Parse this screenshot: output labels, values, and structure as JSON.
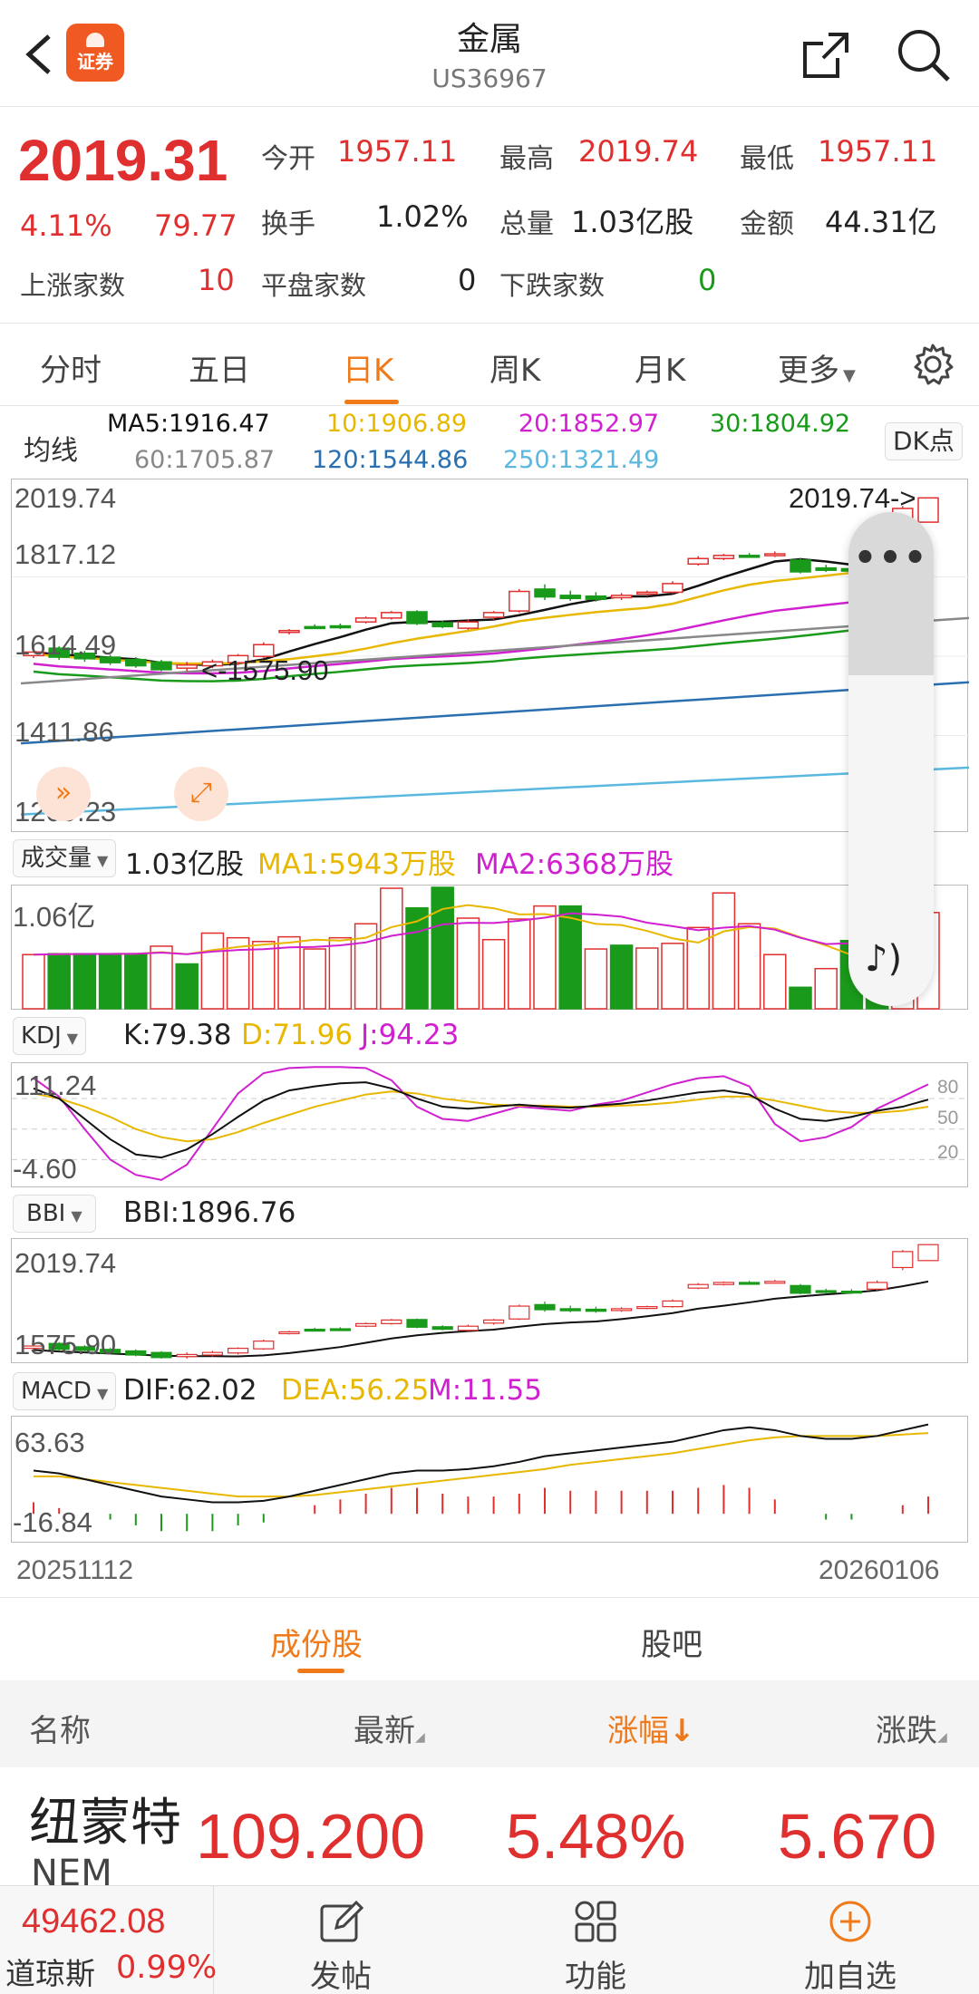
{
  "header": {
    "title": "金属",
    "code": "US36967",
    "logo_text": "证券"
  },
  "quote": {
    "price": "2019.31",
    "change_pct": "4.11%",
    "change": "79.77",
    "open_label": "今开",
    "open": "1957.11",
    "high_label": "最高",
    "high": "2019.74",
    "low_label": "最低",
    "low": "1957.11",
    "turnover_label": "换手",
    "turnover": "1.02%",
    "volume_label": "总量",
    "volume": "1.03亿股",
    "amount_label": "金额",
    "amount": "44.31亿",
    "up_label": "上涨家数",
    "up": "10",
    "flat_label": "平盘家数",
    "flat": "0",
    "down_label": "下跌家数",
    "down": "0"
  },
  "tabs": [
    "分时",
    "五日",
    "日K",
    "周K",
    "月K",
    "更多"
  ],
  "active_tab": "日K",
  "ma": {
    "label": "均线",
    "ma5": "MA5:1916.47",
    "ma10": "10:1906.89",
    "ma20": "20:1852.97",
    "ma30": "30:1804.92",
    "ma60": "60:1705.87",
    "ma120": "120:1544.86",
    "ma250": "250:1321.49",
    "dk_label": "DK点"
  },
  "main_chart": {
    "y_labels": [
      "2019.74",
      "1817.12",
      "1614.49",
      "1411.86",
      "1209.23"
    ],
    "max_annotation": "2019.74->",
    "min_annotation": "<-1575.90"
  },
  "volume": {
    "selector": "成交量",
    "value": "1.03亿股",
    "ma1": "MA1:5943万股",
    "ma2": "MA2:6368万股",
    "y_label": "1.06亿"
  },
  "kdj": {
    "selector": "KDJ",
    "k": "K:79.38",
    "d": "D:71.96",
    "j": "J:94.23",
    "y_top": "111.24",
    "y_bottom": "-4.60",
    "levels": [
      "80",
      "50",
      "20"
    ]
  },
  "bbi": {
    "selector": "BBI",
    "value": "BBI:1896.76",
    "y_top": "2019.74",
    "y_bottom": "1575.90"
  },
  "macd": {
    "selector": "MACD",
    "dif": "DIF:62.02",
    "dea": "DEA:56.25",
    "m": "M:11.55",
    "y_top": "63.63",
    "y_bottom": "-16.84"
  },
  "dates": {
    "start": "20251112",
    "end": "20260106"
  },
  "subtabs": [
    "成份股",
    "股吧"
  ],
  "table": {
    "headers": [
      "名称",
      "最新",
      "涨幅",
      "涨跌"
    ],
    "rows": [
      {
        "name": "纽蒙特",
        "code": "NEM",
        "price": "109.200",
        "pct": "5.48%",
        "chg": "5.670"
      }
    ]
  },
  "bottom": {
    "index_value": "49462.08",
    "index_name": "道琼斯",
    "index_pct": "0.99%",
    "items": [
      "发帖",
      "功能",
      "加自选"
    ]
  },
  "colors": {
    "up": "#e02f2f",
    "down": "#1a9a1a",
    "accent": "#f07a1a",
    "ma5": "#111111",
    "ma10": "#e8b800",
    "ma20": "#d020d0",
    "ma30": "#1a9a1a",
    "ma60": "#888888",
    "ma120": "#2a6fb0",
    "ma250": "#5ab8e0"
  },
  "chart_data": {
    "type": "candlestick",
    "candles": [
      {
        "o": 1616,
        "c": 1625,
        "h": 1630,
        "l": 1610
      },
      {
        "o": 1635,
        "c": 1612,
        "h": 1640,
        "l": 1605
      },
      {
        "o": 1622,
        "c": 1608,
        "h": 1628,
        "l": 1600
      },
      {
        "o": 1612,
        "c": 1598,
        "h": 1618,
        "l": 1592
      },
      {
        "o": 1606,
        "c": 1590,
        "h": 1612,
        "l": 1585
      },
      {
        "o": 1600,
        "c": 1580,
        "h": 1605,
        "l": 1576
      },
      {
        "o": 1584,
        "c": 1592,
        "h": 1600,
        "l": 1576
      },
      {
        "o": 1590,
        "c": 1600,
        "h": 1606,
        "l": 1584
      },
      {
        "o": 1598,
        "c": 1616,
        "h": 1620,
        "l": 1592
      },
      {
        "o": 1614,
        "c": 1644,
        "h": 1650,
        "l": 1610
      },
      {
        "o": 1676,
        "c": 1680,
        "h": 1684,
        "l": 1670
      },
      {
        "o": 1690,
        "c": 1688,
        "h": 1696,
        "l": 1684
      },
      {
        "o": 1692,
        "c": 1688,
        "h": 1698,
        "l": 1684
      },
      {
        "o": 1702,
        "c": 1712,
        "h": 1716,
        "l": 1698
      },
      {
        "o": 1712,
        "c": 1726,
        "h": 1730,
        "l": 1708
      },
      {
        "o": 1728,
        "c": 1698,
        "h": 1732,
        "l": 1694
      },
      {
        "o": 1700,
        "c": 1690,
        "h": 1706,
        "l": 1686
      },
      {
        "o": 1686,
        "c": 1702,
        "h": 1708,
        "l": 1682
      },
      {
        "o": 1714,
        "c": 1726,
        "h": 1730,
        "l": 1708
      },
      {
        "o": 1730,
        "c": 1780,
        "h": 1786,
        "l": 1726
      },
      {
        "o": 1786,
        "c": 1766,
        "h": 1798,
        "l": 1758
      },
      {
        "o": 1770,
        "c": 1762,
        "h": 1782,
        "l": 1756
      },
      {
        "o": 1768,
        "c": 1760,
        "h": 1778,
        "l": 1754
      },
      {
        "o": 1764,
        "c": 1770,
        "h": 1776,
        "l": 1758
      },
      {
        "o": 1774,
        "c": 1778,
        "h": 1782,
        "l": 1768
      },
      {
        "o": 1778,
        "c": 1800,
        "h": 1806,
        "l": 1774
      },
      {
        "o": 1850,
        "c": 1864,
        "h": 1870,
        "l": 1846
      },
      {
        "o": 1864,
        "c": 1872,
        "h": 1876,
        "l": 1860
      },
      {
        "o": 1872,
        "c": 1870,
        "h": 1878,
        "l": 1866
      },
      {
        "o": 1872,
        "c": 1876,
        "h": 1882,
        "l": 1868
      },
      {
        "o": 1860,
        "c": 1830,
        "h": 1866,
        "l": 1826
      },
      {
        "o": 1840,
        "c": 1834,
        "h": 1848,
        "l": 1830
      },
      {
        "o": 1838,
        "c": 1832,
        "h": 1846,
        "l": 1828
      },
      {
        "o": 1846,
        "c": 1872,
        "h": 1880,
        "l": 1840
      },
      {
        "o": 1930,
        "c": 1992,
        "h": 1998,
        "l": 1920
      },
      {
        "o": 1957,
        "c": 2019,
        "h": 2020,
        "l": 1957
      }
    ],
    "volumes": [
      5800,
      5900,
      5900,
      5900,
      5900,
      6700,
      4800,
      8100,
      7600,
      7200,
      7700,
      6400,
      7600,
      9100,
      12900,
      10800,
      13000,
      9700,
      7400,
      9600,
      11000,
      11000,
      6400,
      6800,
      6500,
      7000,
      8700,
      12400,
      9100,
      5800,
      2300,
      4300,
      7300,
      5100,
      3300,
      10300
    ],
    "volume_up": [
      true,
      false,
      false,
      false,
      false,
      true,
      false,
      true,
      true,
      true,
      true,
      true,
      true,
      true,
      true,
      false,
      false,
      true,
      true,
      true,
      true,
      false,
      true,
      false,
      true,
      true,
      true,
      true,
      true,
      true,
      false,
      true,
      false,
      false,
      true,
      true
    ],
    "ylim": [
      1209.23,
      2019.74
    ]
  }
}
